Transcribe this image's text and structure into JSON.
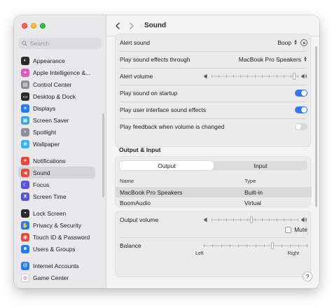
{
  "window": {
    "title": "Sound"
  },
  "sidebar": {
    "search_placeholder": "Search",
    "groups": [
      [
        {
          "label": "Appearance",
          "icon": "appearance-icon",
          "color": "#2b2b2b"
        },
        {
          "label": "Apple Intelligence &...",
          "icon": "apple-intelligence-icon",
          "color": "#e05cb8"
        },
        {
          "label": "Control Center",
          "icon": "control-center-icon",
          "color": "#8e8e93"
        },
        {
          "label": "Desktop & Dock",
          "icon": "desktop-dock-icon",
          "color": "#2b2b2b"
        },
        {
          "label": "Displays",
          "icon": "displays-icon",
          "color": "#1f7cf5"
        },
        {
          "label": "Screen Saver",
          "icon": "screen-saver-icon",
          "color": "#34aadc"
        },
        {
          "label": "Spotlight",
          "icon": "spotlight-icon",
          "color": "#8e8e93"
        },
        {
          "label": "Wallpaper",
          "icon": "wallpaper-icon",
          "color": "#32b5f0"
        }
      ],
      [
        {
          "label": "Notifications",
          "icon": "notifications-icon",
          "color": "#f0453a"
        },
        {
          "label": "Sound",
          "icon": "sound-icon",
          "color": "#f0453a",
          "active": true
        },
        {
          "label": "Focus",
          "icon": "focus-icon",
          "color": "#5856d6"
        },
        {
          "label": "Screen Time",
          "icon": "screen-time-icon",
          "color": "#5856d6"
        }
      ],
      [
        {
          "label": "Lock Screen",
          "icon": "lock-screen-icon",
          "color": "#2b2b2b"
        },
        {
          "label": "Privacy & Security",
          "icon": "privacy-hand-icon",
          "color": "#1f7cf5"
        },
        {
          "label": "Touch ID & Password",
          "icon": "touch-id-icon",
          "color": "#f0453a"
        },
        {
          "label": "Users & Groups",
          "icon": "users-groups-icon",
          "color": "#1f7cf5"
        }
      ],
      [
        {
          "label": "Internet Accounts",
          "icon": "internet-accounts-icon",
          "color": "#1f7cf5"
        },
        {
          "label": "Game Center",
          "icon": "game-center-icon",
          "color": "#ffffff"
        }
      ]
    ]
  },
  "effects": {
    "alert_sound_label": "Alert sound",
    "alert_sound_value": "Boop",
    "play_through_label": "Play sound effects through",
    "play_through_value": "MacBook Pro Speakers",
    "alert_volume_label": "Alert volume",
    "alert_volume_level": 0.97,
    "startup_label": "Play sound on startup",
    "startup_on": true,
    "ui_sounds_label": "Play user interface sound effects",
    "ui_sounds_on": true,
    "feedback_label": "Play feedback when volume is changed",
    "feedback_on": false
  },
  "output_input": {
    "section_title": "Output & Input",
    "tabs": [
      "Output",
      "Input"
    ],
    "selected_tab": 0,
    "columns": [
      "Name",
      "Type"
    ],
    "devices": [
      {
        "name": "MacBook Pro Speakers",
        "type": "Built-in",
        "selected": true
      },
      {
        "name": "BoomAudio",
        "type": "Virtual",
        "selected": false
      }
    ]
  },
  "output": {
    "volume_label": "Output volume",
    "volume_level": 0.46,
    "mute_label": "Mute",
    "muted": false,
    "balance_label": "Balance",
    "balance_level": 0.67,
    "balance_left": "Left",
    "balance_right": "Right"
  },
  "help_label": "?"
}
